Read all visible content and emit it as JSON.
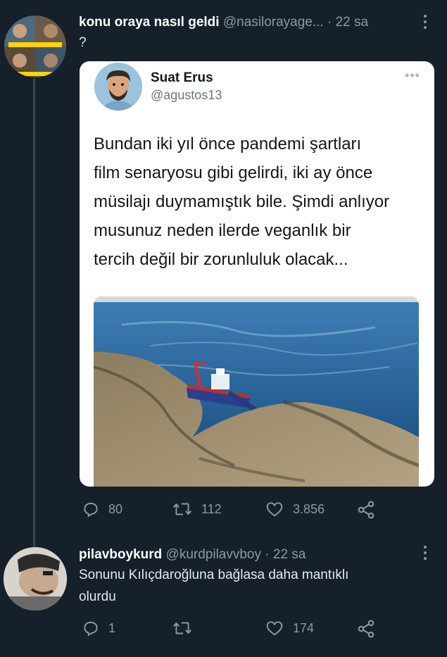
{
  "tweets": [
    {
      "display_name": "konu oraya nasıl geldi",
      "handle": "@nasilorayage...",
      "time": "· 22 sa",
      "text": "?",
      "quoted": {
        "display_name": "Suat Erus",
        "handle": "@agustos13",
        "more": "•••",
        "text_lines": [
          "Bundan iki yıl önce pandemi şartları",
          "film senaryosu gibi gelirdi, iki ay önce",
          "müsilajı duymamıştık bile. Şimdi anlıyor",
          "musunuz neden ilerde veganlık bir",
          "tercih değil bir zorunluluk olacak..."
        ]
      },
      "actions": {
        "replies": "80",
        "retweets": "112",
        "likes": "3.856"
      }
    },
    {
      "display_name": "pilavboykurd",
      "handle": "@kurdpilavvboy",
      "time": "· 22 sa",
      "text_lines": [
        "Sonunu Kılıçdaroğluna bağlasa daha mantıklı",
        "olurdu"
      ],
      "actions": {
        "replies": "1",
        "retweets": "",
        "likes": "174"
      }
    }
  ],
  "colors": {
    "background": "#15202b",
    "icon": "#8b98a5",
    "text": "#e7e9ea"
  },
  "icons": [
    "reply-icon",
    "retweet-icon",
    "like-icon",
    "share-icon",
    "more-vertical-icon"
  ]
}
